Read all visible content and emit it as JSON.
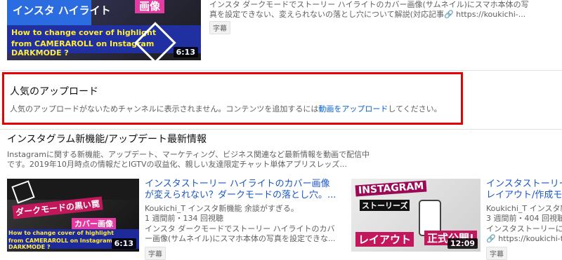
{
  "top_video": {
    "description": [
      "インスタ ダークモードでストーリー ハイライトのカバー画像(サムネイル)にスマホ本体の写",
      "真を設定できない、変えられないの落とし穴について解説(対応記事🔗 https://koukichi-..."
    ],
    "badge": "字幕",
    "duration": "6:13",
    "thumb_text": [
      "インスタ ハイライト",
      "画像",
      "How to change cover of highlight",
      "from CAMERAROLL on Instagram DARKMODE ?"
    ]
  },
  "popular_uploads": {
    "title": "人気のアップロード",
    "message_before": "人気のアップロードがないためチャンネルに表示されません。コンテンツを追加するには",
    "link_text": "動画をアップロード",
    "message_after": "してください。"
  },
  "playlist": {
    "title": "インスタグラム新機能/アップデート最新情報",
    "description": [
      "Instagramに関する新機能、アップデート、マーケティング、ビジネス関連など最新情報を動画で配信中",
      "です。2019年10月時点の情報だとIGTVの収益化、親しい友達限定チャット単体アプリスレッズ..."
    ]
  },
  "videos": [
    {
      "title": [
        "インスタストーリー ハイライトのカバー画像",
        "が変えられない？ダークモードの落とし穴。..."
      ],
      "channel": "Koukichi_T インスタ新機能 余談がすぎる。",
      "stats": "1 週間前・134 回視聴",
      "description": [
        "インスタ ダークモードでストーリー ハイライトのカバ",
        "ー画像(サムネイル)にスマホ本体の写真を設定できな..."
      ],
      "badge": "字幕",
      "duration": "6:13",
      "thumb_text": [
        "ダークモードの黒い罠",
        "カバー画像",
        "How to change cover of highlight",
        "from CAMERAROLL on Instagram DARKMODE ?"
      ]
    },
    {
      "title": [
        "インスタストーリー",
        "レイアウト/作成モ"
      ],
      "channel": "Koukichi_T インスタ新",
      "stats": "3 週間前・404 回視聴",
      "description": [
        "インスタストーリーに",
        "🔗 https://koukichi-t."
      ],
      "badge": "字幕",
      "duration": "12:09",
      "thumb_text": [
        "INSTAGRAM",
        "ストーリーズ",
        "レイアウト",
        "正式公開!"
      ]
    }
  ],
  "colors": {
    "highlight_border": "#e60000",
    "link": "#065fd4"
  }
}
